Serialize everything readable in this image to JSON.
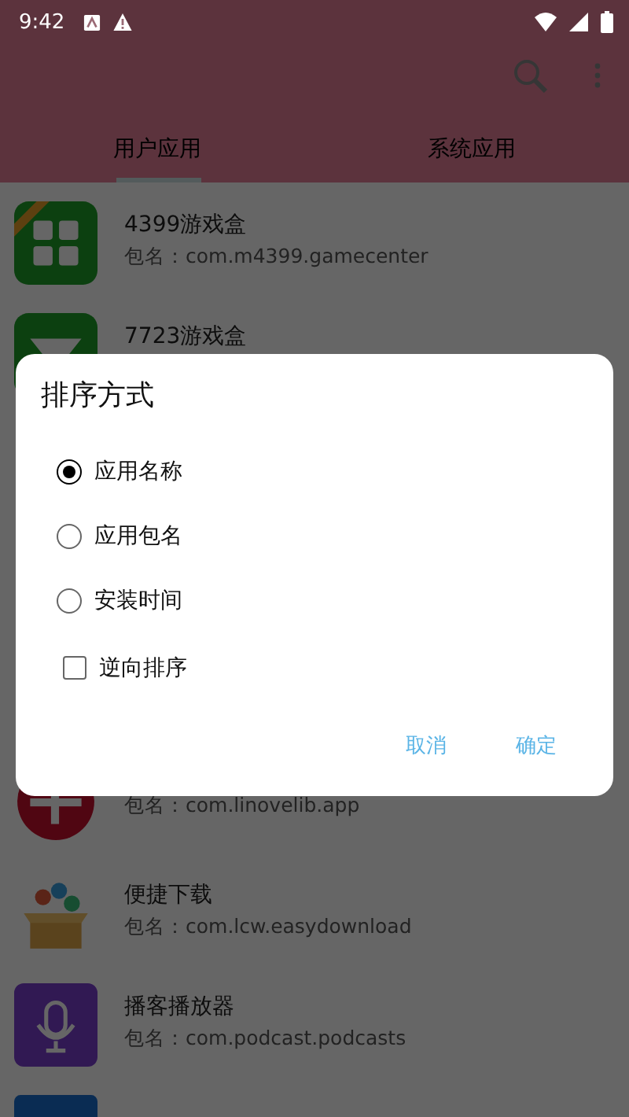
{
  "status_bar": {
    "time": "9:42"
  },
  "tabs": [
    {
      "label": "用户应用",
      "selected": true
    },
    {
      "label": "系统应用",
      "selected": false
    }
  ],
  "apps": [
    {
      "kind": "games",
      "name": "4399游戏盒",
      "package": "包名：com.m4399.gamecenter"
    },
    {
      "kind": "chevron",
      "name": "7723游戏盒"
    },
    {
      "kind": "redcircle",
      "package": "包名：com.linovelib.app"
    },
    {
      "kind": "box",
      "name": "便捷下载",
      "package": "包名：com.lcw.easydownload"
    },
    {
      "kind": "podcast",
      "name": "播客播放器",
      "package": "包名：com.podcast.podcasts"
    },
    {
      "kind": "blue"
    }
  ],
  "dialog": {
    "title": "排序方式",
    "options": [
      {
        "label": "应用名称",
        "selected": true
      },
      {
        "label": "应用包名",
        "selected": false
      },
      {
        "label": "安装时间",
        "selected": false
      }
    ],
    "reverse": {
      "label": "逆向排序",
      "checked": false
    },
    "buttons": [
      "取消",
      "确定"
    ]
  }
}
